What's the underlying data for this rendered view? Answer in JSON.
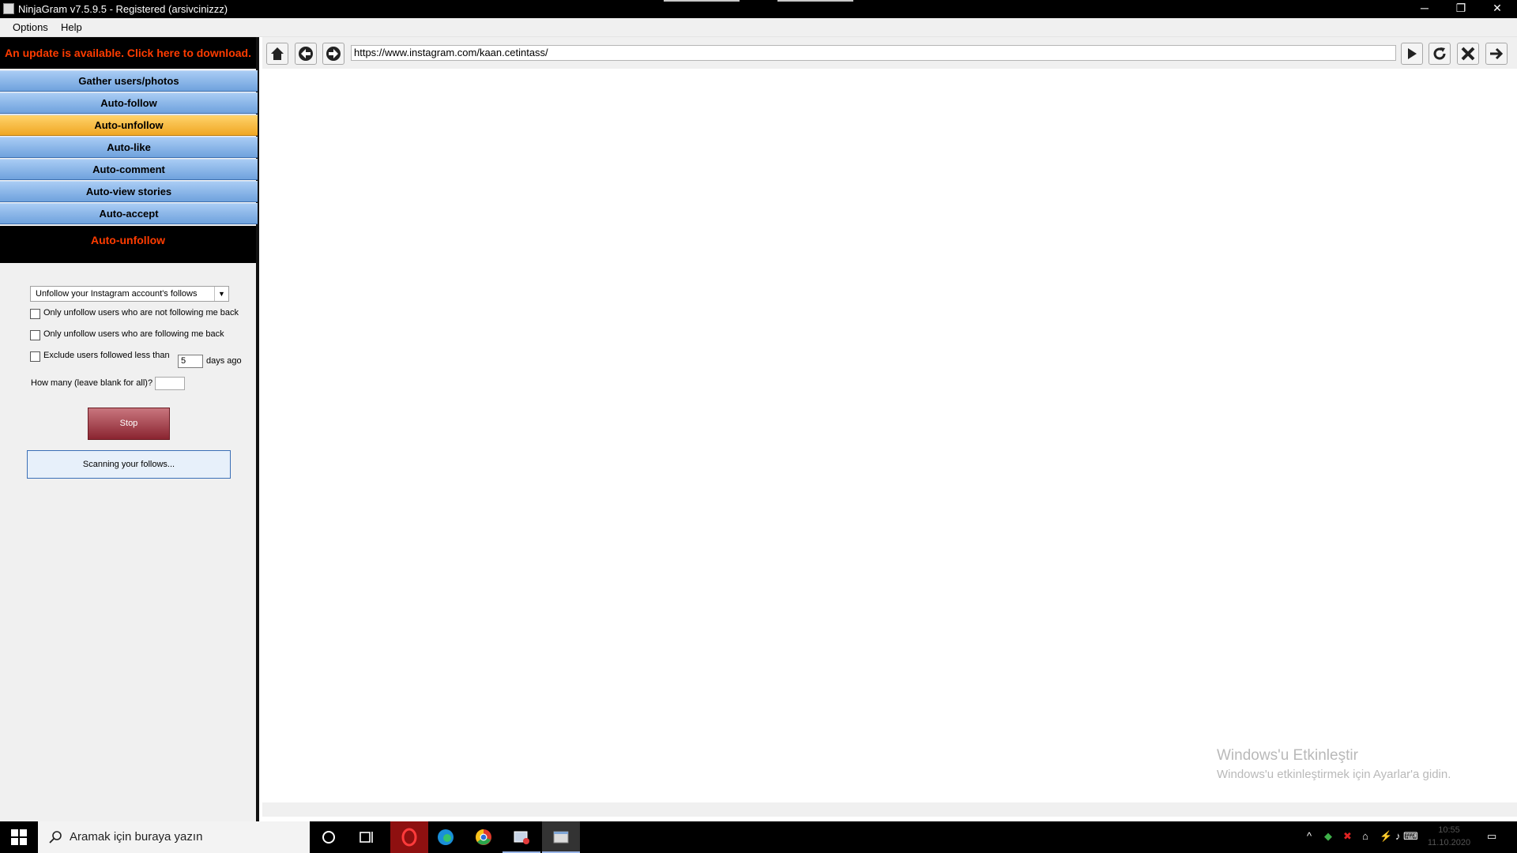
{
  "window": {
    "title": "NinjaGram v7.5.9.5 - Registered (arsivcinizzz)",
    "controls": {
      "minimize": "─",
      "restore": "❐",
      "close": "✕"
    }
  },
  "menu": {
    "items": [
      "Options",
      "Help"
    ]
  },
  "sidebar": {
    "update_banner": "An update is available. Click here to download.",
    "nav": [
      {
        "label": "Gather users/photos",
        "active": false
      },
      {
        "label": "Auto-follow",
        "active": false
      },
      {
        "label": "Auto-unfollow",
        "active": true
      },
      {
        "label": "Auto-like",
        "active": false
      },
      {
        "label": "Auto-comment",
        "active": false
      },
      {
        "label": "Auto-view stories",
        "active": false
      },
      {
        "label": "Auto-accept",
        "active": false
      }
    ],
    "section_title": "Auto-unfollow"
  },
  "unfollow_form": {
    "mode_select": "Unfollow your Instagram account's follows",
    "options": [
      {
        "label": "Only unfollow users who are not following me back",
        "checked": false
      },
      {
        "label": "Only unfollow users who are following me back",
        "checked": false
      },
      {
        "label": "Exclude users followed less than",
        "checked": false
      }
    ],
    "days_value": "5",
    "days_suffix": "days ago",
    "how_many_label": "How many (leave blank for all)?",
    "how_many_value": "",
    "stop_label": "Stop",
    "status_text": "Scanning your follows..."
  },
  "browser": {
    "url": "https://www.instagram.com/kaan.cetintass/",
    "buttons": [
      "home-icon",
      "back-icon",
      "forward-icon",
      "go-icon",
      "refresh-icon",
      "stop-icon",
      "exit-icon"
    ]
  },
  "watermark": {
    "line1": "Windows'u Etkinleştir",
    "line2": "Windows'u etkinleştirmek için Ayarlar'a gidin."
  },
  "taskbar": {
    "search_placeholder": "Aramak için buraya yazın",
    "clock_time": "10:55",
    "clock_date": "11.10.2020"
  },
  "colors": {
    "nav_blue": "#8ab7ec",
    "nav_active": "#f5b93a",
    "banner_text": "#ff3c00",
    "stop_button": "#9b3440"
  }
}
